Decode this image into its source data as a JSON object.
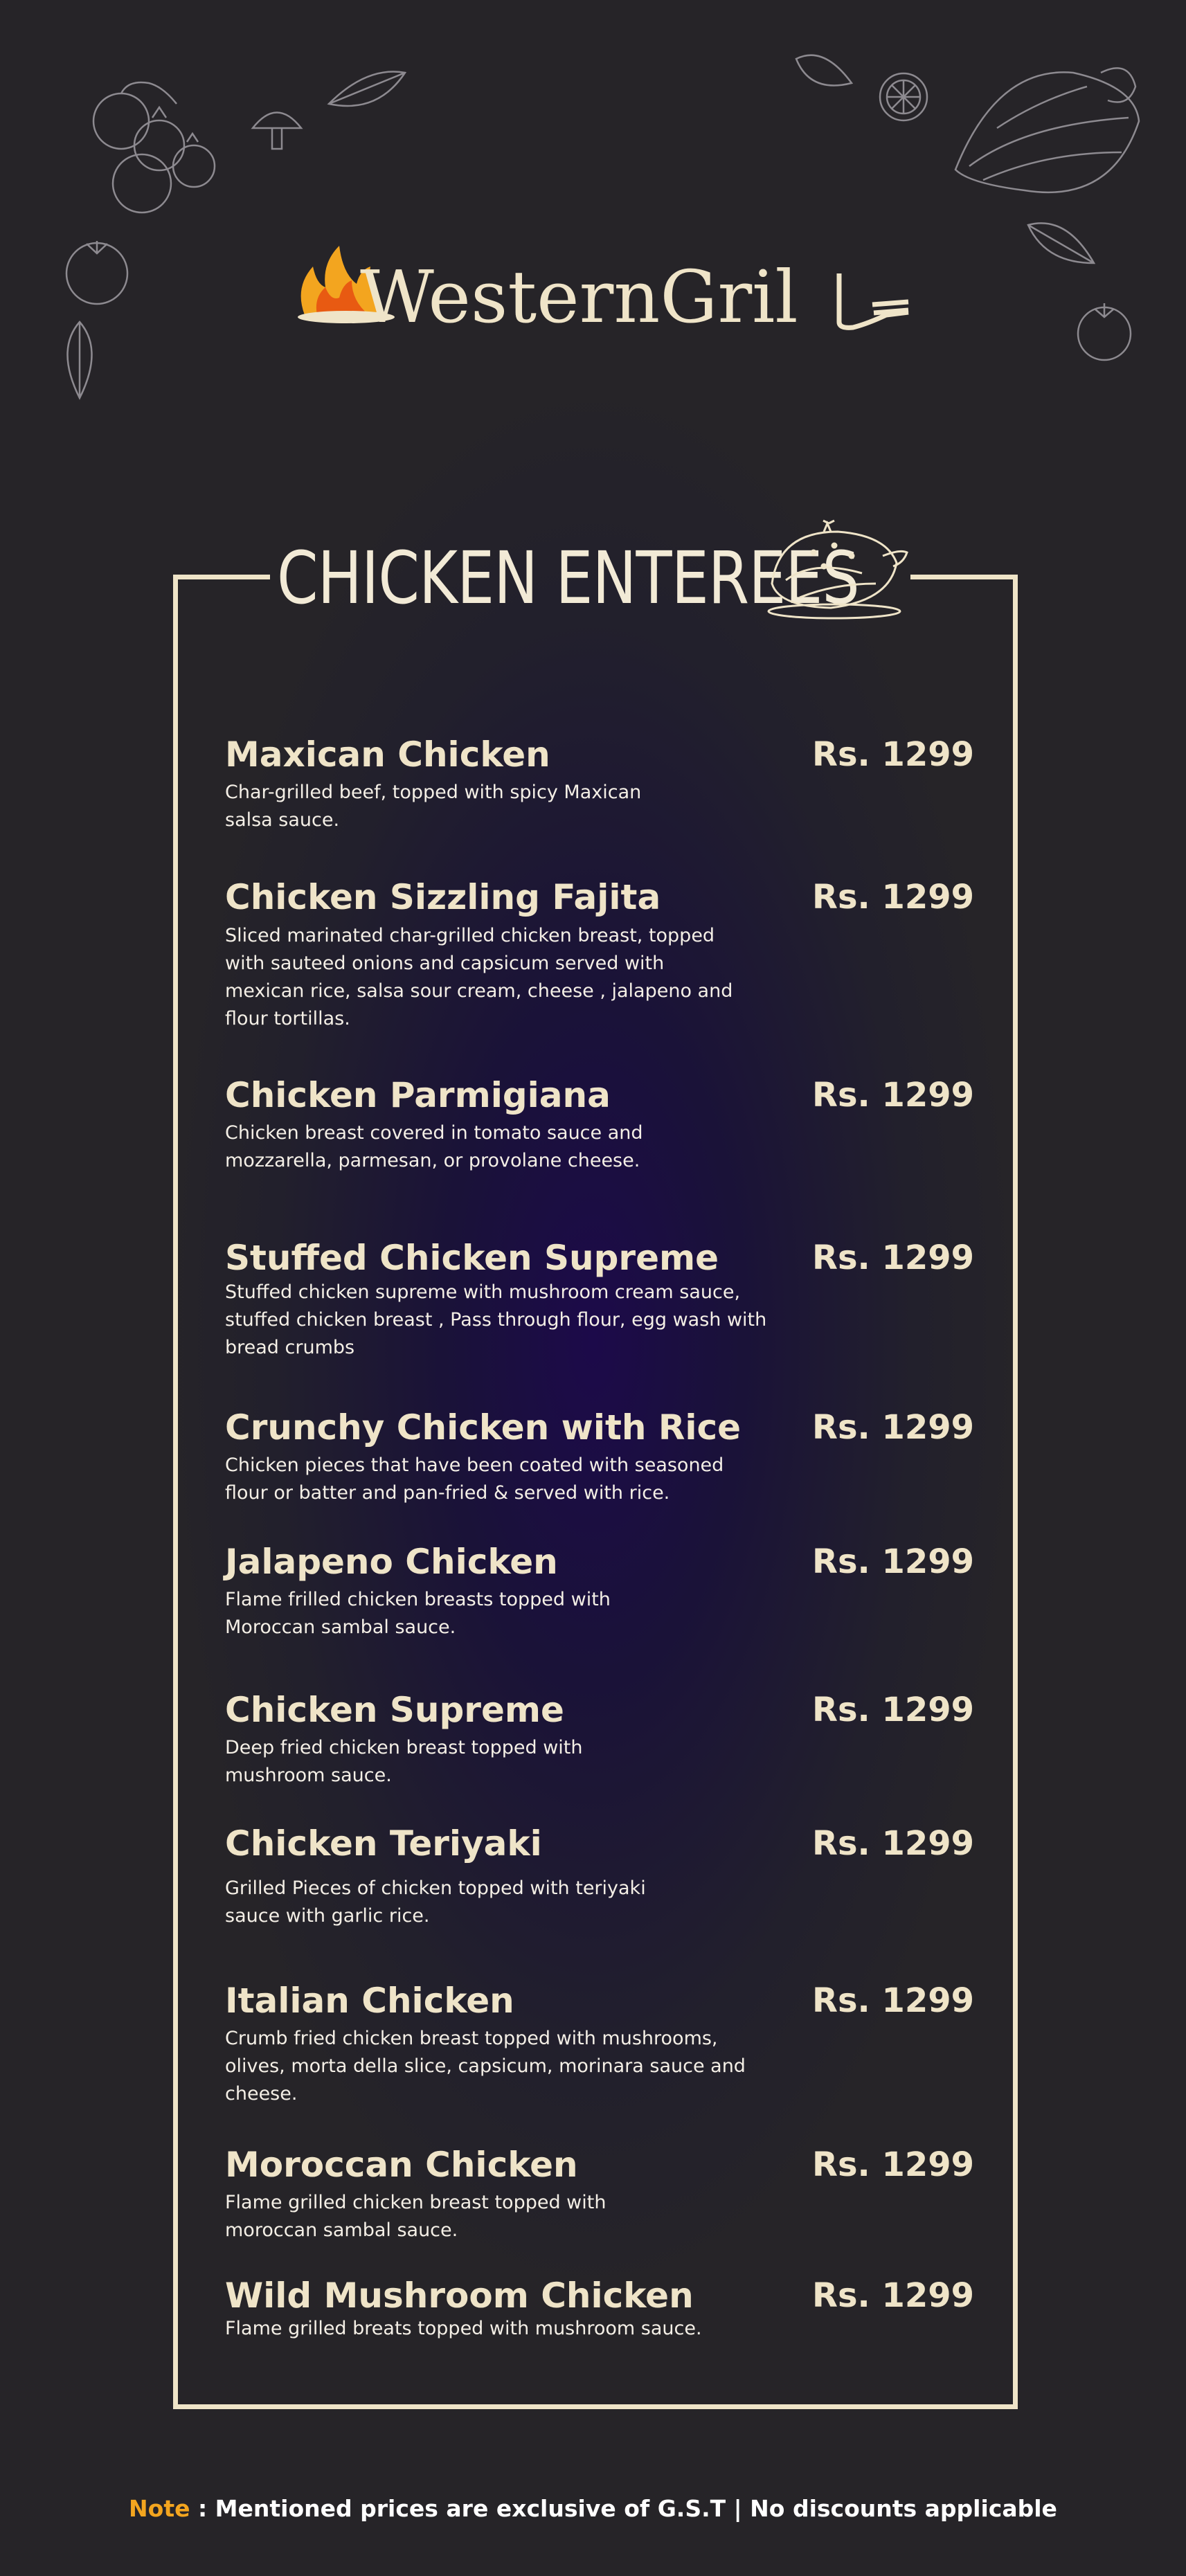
{
  "brand": {
    "name": "WesternGrill"
  },
  "section": {
    "title": "CHICKEN ENTEREES"
  },
  "items": [
    {
      "name": "Maxican Chicken",
      "price": "Rs. 1299",
      "desc": "Char-grilled beef, topped with spicy Maxican salsa sauce."
    },
    {
      "name": "Chicken Sizzling Fajita",
      "price": "Rs. 1299",
      "desc": "Sliced marinated char-grilled chicken breast, topped with sauteed onions and capsicum served with mexican rice, salsa sour cream, cheese , jalapeno and flour tortillas."
    },
    {
      "name": "Chicken Parmigiana",
      "price": "Rs. 1299",
      "desc": "Chicken breast covered in tomato sauce and mozzarella, parmesan, or provolane cheese."
    },
    {
      "name": "Stuffed Chicken Supreme",
      "price": "Rs. 1299",
      "desc": "Stuffed chicken supreme with mushroom cream sauce, stuffed chicken breast , Pass through flour, egg wash with bread crumbs"
    },
    {
      "name": "Crunchy Chicken with Rice",
      "price": "Rs. 1299",
      "desc": "Chicken pieces that have been coated with seasoned flour or batter and pan-fried & served with rice."
    },
    {
      "name": "Jalapeno Chicken",
      "price": "Rs. 1299",
      "desc": "Flame frilled chicken breasts topped with Moroccan sambal sauce."
    },
    {
      "name": "Chicken Supreme",
      "price": "Rs. 1299",
      "desc": "Deep fried chicken breast topped with mushroom sauce."
    },
    {
      "name": "Chicken Teriyaki",
      "price": "Rs. 1299",
      "desc": "Grilled Pieces of chicken topped with teriyaki sauce with garlic rice."
    },
    {
      "name": "Italian Chicken",
      "price": "Rs. 1299",
      "desc": "Crumb fried chicken breast topped with mushrooms, olives, morta della slice, capsicum, morinara sauce and cheese."
    },
    {
      "name": "Moroccan Chicken",
      "price": "Rs. 1299",
      "desc": "Flame grilled chicken breast topped with moroccan sambal sauce."
    },
    {
      "name": "Wild Mushroom Chicken",
      "price": "Rs. 1299",
      "desc": "Flame grilled breats topped with mushroom sauce."
    }
  ],
  "note": {
    "label": "Note",
    "text": " : Mentioned prices are exclusive of G.S.T | No discounts applicable"
  },
  "colors": {
    "accent": "#f3a51f",
    "cream": "#efe4c8",
    "background": "#242228"
  },
  "icons": [
    "tomato-sketch-icon",
    "basil-leaf-icon",
    "mushroom-sketch-icon",
    "lime-slice-icon",
    "bok-choy-icon",
    "roast-turkey-icon",
    "flame-icon",
    "fork-icon"
  ]
}
